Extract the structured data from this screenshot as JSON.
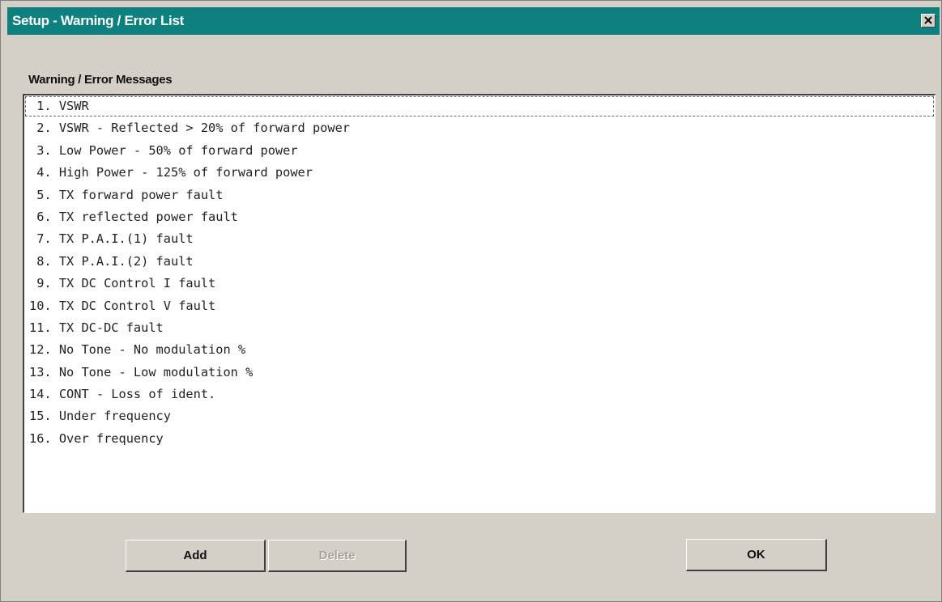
{
  "window": {
    "title": "Setup - Warning / Error List"
  },
  "group": {
    "label": "Warning / Error Messages"
  },
  "messages": [
    " 1. VSWR",
    " 2. VSWR - Reflected > 20% of forward power",
    " 3. Low Power - 50% of forward power",
    " 4. High Power - 125% of forward power",
    " 5. TX forward power fault",
    " 6. TX reflected power fault",
    " 7. TX P.A.I.(1) fault",
    " 8. TX P.A.I.(2) fault",
    " 9. TX DC Control I fault",
    "10. TX DC Control V fault",
    "11. TX DC-DC fault",
    "12. No Tone - No modulation %",
    "13. No Tone - Low modulation %",
    "14. CONT - Loss of ident.",
    "15. Under frequency",
    "16. Over frequency"
  ],
  "selected_index": 0,
  "buttons": {
    "add": "Add",
    "delete": "Delete",
    "ok": "OK"
  },
  "colors": {
    "titlebar": "#0f8080",
    "dialog_bg": "#d4d0c8"
  },
  "icons": {
    "close": "close-icon"
  }
}
